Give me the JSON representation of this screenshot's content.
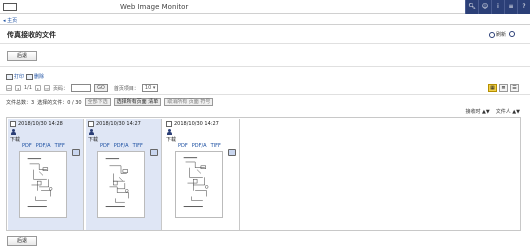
{
  "header": {
    "app_title": "Web Image Monitor",
    "icons": [
      "search-icon",
      "user-icon",
      "info-icon",
      "menu-icon",
      "help-icon"
    ]
  },
  "breadcrumb": {
    "home": "◂ 主页"
  },
  "page": {
    "title": "传真接收的文件",
    "refresh_label": "刷新",
    "help_label": ""
  },
  "buttons": {
    "back_top": "后退",
    "back_bottom": "后退"
  },
  "toolbar": {
    "print": "打印",
    "delete": "删除"
  },
  "pager": {
    "current": "1/1",
    "page_label": "页码：",
    "page_value": "",
    "go": "GO",
    "per_page_label": "首页项目：",
    "per_page_value": "10 ▾"
  },
  "info": {
    "total": "文件总数：3",
    "selected": "选择的文件：0 / 30",
    "select_all": "全部下选",
    "select_all_pages": "选择所有页面 清单",
    "deselect_all": "取消所有 页面 符号"
  },
  "sort": {
    "by_date": "接收时 ▲▼",
    "by_name": "文件人 ▲▼"
  },
  "files": [
    {
      "datetime": "2018/10/30 14:28",
      "download": "下载",
      "formats": [
        "PDF",
        "PDF/A",
        "TIFF"
      ],
      "selected_style": true
    },
    {
      "datetime": "2018/10/30 14:27",
      "download": "下载",
      "formats": [
        "PDF",
        "PDF/A",
        "TIFF"
      ],
      "selected_style": true
    },
    {
      "datetime": "2018/10/30 14:27",
      "download": "下载",
      "formats": [
        "PDF",
        "PDF/A",
        "TIFF"
      ],
      "selected_style": false
    }
  ],
  "colors": {
    "header_bar": "#2b3f77",
    "link": "#1a4ea1",
    "card_bg": "#dfe6f5",
    "active_view": "#f2d14a"
  }
}
